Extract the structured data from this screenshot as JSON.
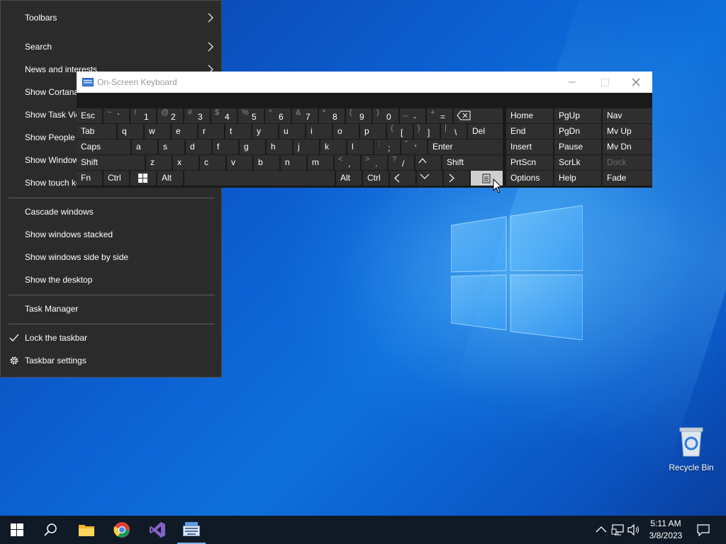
{
  "desktop": {
    "recycle_bin_label": "Recycle Bin"
  },
  "context_menu": {
    "items": [
      {
        "label": "Toolbars",
        "submenu": true
      },
      {
        "label": "Search",
        "submenu": true
      },
      {
        "label": "News and interests",
        "submenu": true
      },
      {
        "label": "Show Cortana button"
      },
      {
        "label": "Show Task View button"
      },
      {
        "label": "Show People on the taskbar"
      },
      {
        "label": "Show Windows Ink Workspace button"
      },
      {
        "label": "Show touch keyboard button"
      },
      {
        "label": "Cascade windows"
      },
      {
        "label": "Show windows stacked"
      },
      {
        "label": "Show windows side by side"
      },
      {
        "label": "Show the desktop"
      },
      {
        "label": "Task Manager"
      },
      {
        "label": "Lock the taskbar",
        "checked": true
      },
      {
        "label": "Taskbar settings",
        "icon": "gear-icon"
      }
    ]
  },
  "osk": {
    "title": "On-Screen Keyboard",
    "rows": {
      "r1": [
        {
          "lbl": "Esc"
        },
        {
          "shift": "~",
          "pri": "`"
        },
        {
          "shift": "!",
          "pri": "1"
        },
        {
          "shift": "@",
          "pri": "2"
        },
        {
          "shift": "#",
          "pri": "3"
        },
        {
          "shift": "$",
          "pri": "4"
        },
        {
          "shift": "%",
          "pri": "5"
        },
        {
          "shift": "^",
          "pri": "6"
        },
        {
          "shift": "&",
          "pri": "7"
        },
        {
          "shift": "*",
          "pri": "8"
        },
        {
          "shift": "(",
          "pri": "9"
        },
        {
          "shift": ")",
          "pri": "0"
        },
        {
          "shift": "_",
          "pri": "-"
        },
        {
          "shift": "+",
          "pri": "="
        }
      ],
      "r2": [
        {
          "lbl": "Tab"
        },
        {
          "lbl": "q"
        },
        {
          "lbl": "w"
        },
        {
          "lbl": "e"
        },
        {
          "lbl": "r"
        },
        {
          "lbl": "t"
        },
        {
          "lbl": "y"
        },
        {
          "lbl": "u"
        },
        {
          "lbl": "i"
        },
        {
          "lbl": "o"
        },
        {
          "lbl": "p"
        },
        {
          "shift": "{",
          "pri": "["
        },
        {
          "shift": "}",
          "pri": "]"
        },
        {
          "shift": "|",
          "pri": "\\"
        },
        {
          "lbl": "Del"
        }
      ],
      "r3": [
        {
          "lbl": "Caps"
        },
        {
          "lbl": "a"
        },
        {
          "lbl": "s"
        },
        {
          "lbl": "d"
        },
        {
          "lbl": "f"
        },
        {
          "lbl": "g"
        },
        {
          "lbl": "h"
        },
        {
          "lbl": "j"
        },
        {
          "lbl": "k"
        },
        {
          "lbl": "l"
        },
        {
          "shift": ":",
          "pri": ";"
        },
        {
          "shift": "\"",
          "pri": "'"
        },
        {
          "lbl": "Enter"
        }
      ],
      "r4": [
        {
          "lbl": "Shift"
        },
        {
          "lbl": "z"
        },
        {
          "lbl": "x"
        },
        {
          "lbl": "c"
        },
        {
          "lbl": "v"
        },
        {
          "lbl": "b"
        },
        {
          "lbl": "n"
        },
        {
          "lbl": "m"
        },
        {
          "shift": "<",
          "pri": ","
        },
        {
          "shift": ">",
          "pri": "."
        },
        {
          "shift": "?",
          "pri": "/"
        },
        {
          "lbl": "Shift"
        }
      ],
      "r5": [
        {
          "lbl": "Fn"
        },
        {
          "lbl": "Ctrl"
        },
        {
          "lbl": "Alt"
        },
        {
          "lbl": "Alt"
        },
        {
          "lbl": "Ctrl"
        }
      ]
    },
    "nav_keys": {
      "home": "Home",
      "pgup": "PgUp",
      "nav": "Nav",
      "end": "End",
      "pgdn": "PgDn",
      "mvup": "Mv Up",
      "insert": "Insert",
      "pause": "Pause",
      "mvdn": "Mv Dn",
      "prtscn": "PrtScn",
      "scrlk": "ScrLk",
      "dock": "Dock",
      "options": "Options",
      "help": "Help",
      "fade": "Fade"
    }
  },
  "taskbar": {
    "time": "5:11 AM",
    "date": "3/8/2023",
    "pinned": [
      "start-icon",
      "search-icon",
      "file-explorer-icon",
      "chrome-icon",
      "visual-studio-icon",
      "on-screen-keyboard-icon"
    ]
  }
}
